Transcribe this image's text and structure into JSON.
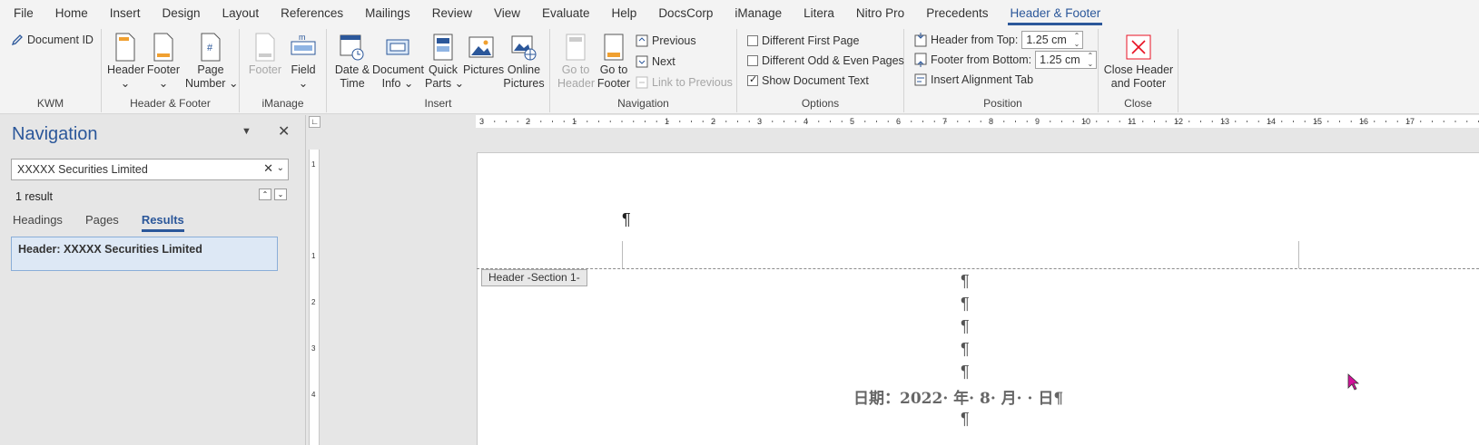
{
  "tabs": [
    "File",
    "Home",
    "Insert",
    "Design",
    "Layout",
    "References",
    "Mailings",
    "Review",
    "View",
    "Evaluate",
    "Help",
    "DocsCorp",
    "iManage",
    "Litera",
    "Nitro Pro",
    "Precedents",
    "Header & Footer"
  ],
  "ribbon": {
    "kwm": {
      "label": "KWM",
      "document_id": "Document ID"
    },
    "hf": {
      "label": "Header & Footer",
      "header": "Header",
      "footer": "Footer",
      "page_number_1": "Page",
      "page_number_2": "Number"
    },
    "imanage": {
      "label": "iManage",
      "footer": "Footer",
      "field": "Field"
    },
    "insert": {
      "label": "Insert",
      "date_1": "Date &",
      "date_2": "Time",
      "docinfo_1": "Document",
      "docinfo_2": "Info",
      "quick_1": "Quick",
      "quick_2": "Parts",
      "pictures": "Pictures",
      "online_1": "Online",
      "online_2": "Pictures"
    },
    "navigation": {
      "label": "Navigation",
      "goto_header_1": "Go to",
      "goto_header_2": "Header",
      "goto_footer_1": "Go to",
      "goto_footer_2": "Footer",
      "previous": "Previous",
      "next": "Next",
      "link_prev": "Link to Previous"
    },
    "options": {
      "label": "Options",
      "diff_first": "Different First Page",
      "diff_odd": "Different Odd & Even Pages",
      "show_doc": "Show Document Text"
    },
    "position": {
      "label": "Position",
      "header_from_top": "Header from Top:",
      "header_val": "1.25 cm",
      "footer_from_bottom": "Footer from Bottom:",
      "footer_val": "1.25 cm",
      "align_tab": "Insert Alignment Tab"
    },
    "close": {
      "label": "Close",
      "close_1": "Close Header",
      "close_2": "and Footer"
    }
  },
  "nav": {
    "title": "Navigation",
    "search_value": "XXXXX Securities Limited",
    "result_count": "1 result",
    "tabs": [
      "Headings",
      "Pages",
      "Results"
    ],
    "active_tab": "Results",
    "result": "Header: XXXXX Securities Limited"
  },
  "ruler": {
    "h": [
      "3",
      "2",
      "1",
      "1",
      "2",
      "3",
      "4",
      "5",
      "6",
      "7",
      "8",
      "9",
      "10",
      "11",
      "12",
      "13",
      "14",
      "15",
      "16",
      "17"
    ],
    "v": [
      "1",
      "1",
      "2",
      "3",
      "4"
    ]
  },
  "doc": {
    "header_tag": "Header -Section 1-",
    "pilcrow": "¶",
    "date_line": "日期：2022· 年· 8· 月· · 日¶"
  },
  "colors": {
    "accent": "#2b579a",
    "close_red": "#e81123"
  }
}
